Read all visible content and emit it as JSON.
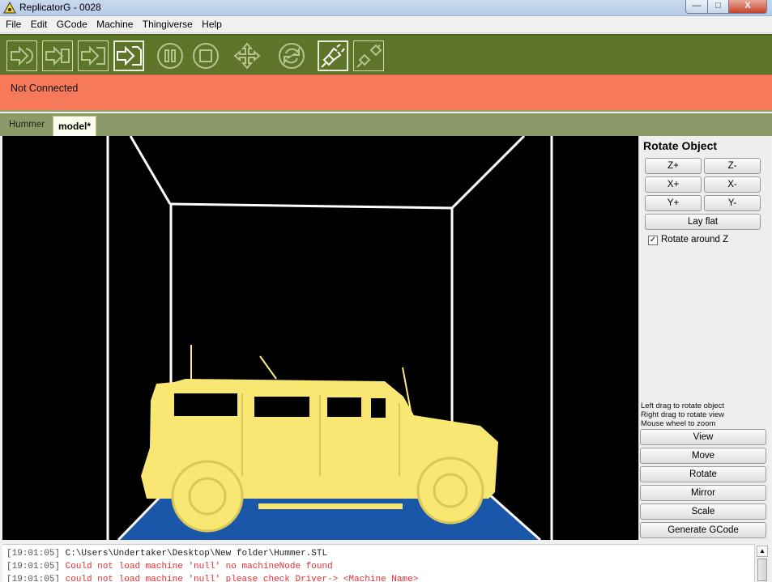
{
  "window": {
    "title": "ReplicatorG - 0028",
    "min_glyph": "—",
    "max_glyph": "□",
    "close_glyph": "X"
  },
  "menu": [
    "File",
    "Edit",
    "GCode",
    "Machine",
    "Thingiverse",
    "Help"
  ],
  "toolbar": {
    "buttons": [
      {
        "name": "build-icon",
        "state": "disabled"
      },
      {
        "name": "upload-icon",
        "state": "disabled"
      },
      {
        "name": "build-to-file-icon",
        "state": "disabled"
      },
      {
        "name": "generate-gcode-icon",
        "state": "active"
      },
      {
        "name": "pause-icon",
        "state": "disabled"
      },
      {
        "name": "stop-icon",
        "state": "disabled"
      },
      {
        "name": "control-panel-icon",
        "state": "disabled"
      },
      {
        "name": "reset-icon",
        "state": "disabled"
      },
      {
        "name": "connect-icon",
        "state": "active"
      },
      {
        "name": "disconnect-icon",
        "state": "disabled"
      }
    ]
  },
  "status": {
    "text": "Not Connected",
    "color": "#f6795b"
  },
  "tabs": [
    {
      "label": "Hummer",
      "active": false
    },
    {
      "label": "model*",
      "active": true
    }
  ],
  "panel": {
    "title": "Rotate Object",
    "rotate_buttons": [
      "Z+",
      "Z-",
      "X+",
      "X-",
      "Y+",
      "Y-"
    ],
    "lay_flat": "Lay flat",
    "rotate_around_z": {
      "label": "Rotate around Z",
      "checked": true,
      "check_glyph": "✓"
    },
    "hints": [
      "Left drag to rotate object",
      "Right drag to rotate view",
      "Mouse wheel to zoom"
    ],
    "mode_buttons": [
      "View",
      "Move",
      "Rotate",
      "Mirror",
      "Scale",
      "Generate GCode"
    ]
  },
  "console": {
    "lines": [
      {
        "time": "[19:01:05]",
        "text": "C:\\Users\\Undertaker\\Desktop\\New folder\\Hummer.STL",
        "level": "info"
      },
      {
        "time": "[19:01:05]",
        "text": "Could not load machine 'null' no machineNode found",
        "level": "error"
      },
      {
        "time": "[19:01:05]",
        "text": "could not load machine 'null' please check Driver-> <Machine Name>",
        "level": "error"
      }
    ],
    "scroll_up_glyph": "▲"
  },
  "colors": {
    "toolbar": "#5e7429",
    "status": "#f6795b",
    "tabstrip": "#8c9a68",
    "model": "#fbef7a",
    "platform": "#1b57a8"
  }
}
